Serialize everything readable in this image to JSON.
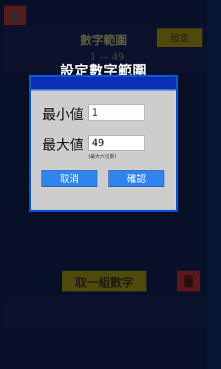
{
  "app": {
    "range_title": "數字範圍",
    "settings_label": "設定",
    "range_display": "1 — 49",
    "pick_label": "取一組數字"
  },
  "dialog": {
    "title": "設定數字範圍",
    "min_label": "最小値",
    "min_value": "1",
    "max_label": "最大値",
    "max_value": "49",
    "max_hint": "(最大六位數)",
    "cancel_label": "取消",
    "confirm_label": "確認"
  },
  "colors": {
    "background": "#0a1636",
    "dialog_border": "#0a55d0",
    "dialog_body": "#cdcdcd",
    "button": "#2f84ee",
    "accent_yellow": "#6a6410",
    "danger_red": "#7a2020"
  },
  "icons": [
    "close-icon",
    "trash-icon"
  ]
}
